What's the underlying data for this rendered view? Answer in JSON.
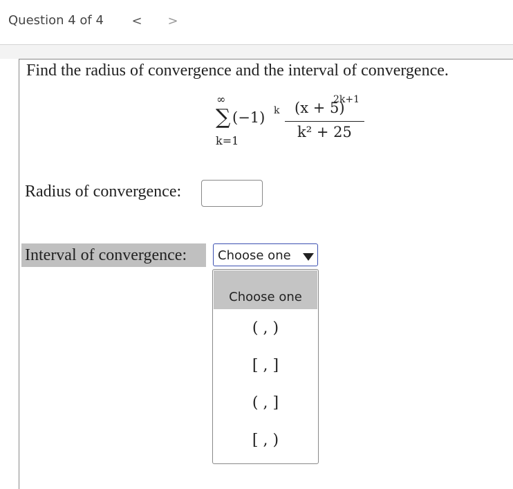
{
  "header": {
    "question_counter": "Question 4 of 4",
    "prev_glyph": "<",
    "next_glyph": ">"
  },
  "problem": {
    "prompt": "Find the radius of convergence and the interval of convergence.",
    "series": {
      "upper_limit": "∞",
      "lower_limit": "k=1",
      "sigma": "∑",
      "factor": "(−1)",
      "factor_exponent": "k",
      "numerator_base": "(x + 5)",
      "numerator_exponent": "2k+1",
      "denominator": "k² + 25"
    }
  },
  "radius": {
    "label": "Radius of convergence:",
    "value": ""
  },
  "interval": {
    "label": "Interval of convergence:",
    "selected": "Choose one",
    "options": [
      "Choose one",
      "( ,  )",
      "[ ,  ]",
      "( ,  ]",
      "[ ,  )"
    ]
  }
}
